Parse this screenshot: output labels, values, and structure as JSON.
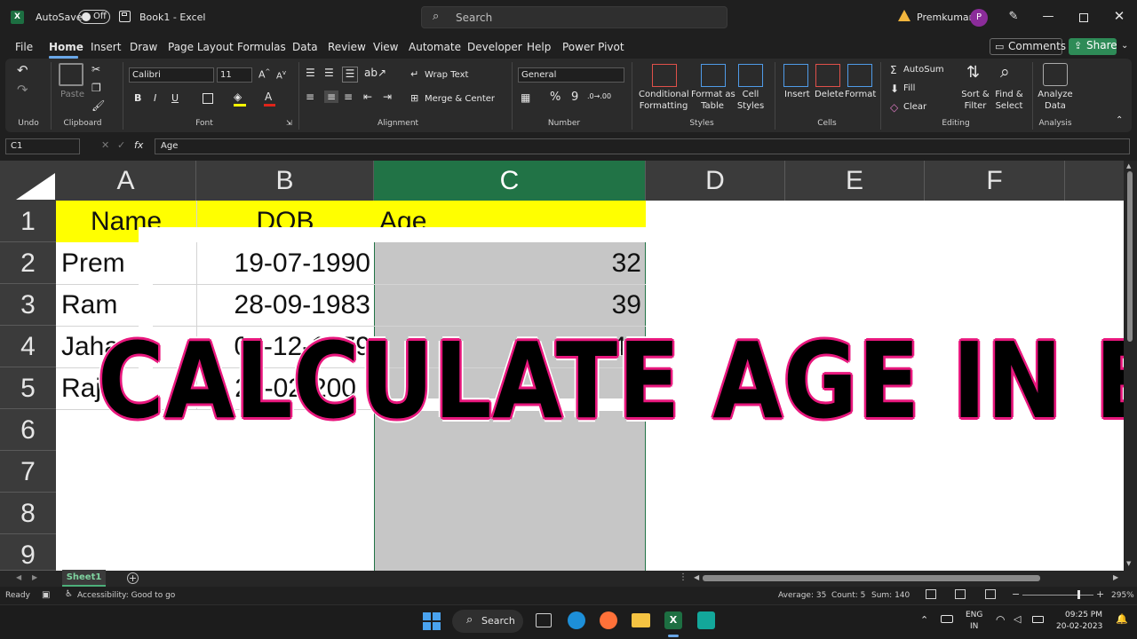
{
  "titlebar": {
    "autosave_label": "AutoSave",
    "autosave_state": "Off",
    "doc_title": "Book1  -  Excel",
    "search_placeholder": "Search",
    "user_name": "Premkumar",
    "avatar_initial": "P"
  },
  "menu": {
    "tabs": [
      "File",
      "Home",
      "Insert",
      "Draw",
      "Page Layout",
      "Formulas",
      "Data",
      "Review",
      "View",
      "Automate",
      "Developer",
      "Help",
      "Power Pivot"
    ],
    "active_tab": "Home",
    "comments_label": "Comments",
    "share_label": "Share"
  },
  "ribbon": {
    "undo_label": "Undo",
    "clipboard_label": "Clipboard",
    "paste_label": "Paste",
    "font_label": "Font",
    "font_name": "Calibri",
    "font_size": "11",
    "alignment_label": "Alignment",
    "wrap_text": "Wrap Text",
    "merge_center": "Merge & Center",
    "number_label": "Number",
    "number_format": "General",
    "styles_label": "Styles",
    "cond_format": [
      "Conditional",
      "Formatting"
    ],
    "format_table": [
      "Format as",
      "Table"
    ],
    "cell_styles": [
      "Cell",
      "Styles"
    ],
    "cells_label": "Cells",
    "insert": "Insert",
    "delete": "Delete",
    "format": "Format",
    "editing_label": "Editing",
    "autosum": "AutoSum",
    "fill": "Fill",
    "clear": "Clear",
    "sort_filter": [
      "Sort &",
      "Filter"
    ],
    "find_select": [
      "Find &",
      "Select"
    ],
    "analysis_label": "Analysis",
    "analyze_data": [
      "Analyze",
      "Data"
    ]
  },
  "formula_bar": {
    "name_box": "C1",
    "content": "Age"
  },
  "sheet": {
    "columns": [
      "A",
      "B",
      "C",
      "D",
      "E",
      "F"
    ],
    "rows": [
      "1",
      "2",
      "3",
      "4",
      "5",
      "6",
      "7",
      "8",
      "9"
    ],
    "header_row": {
      "a": "Name",
      "b": "DOB",
      "c": "Age"
    },
    "data": [
      {
        "a": "Prem",
        "b": "19-07-1990",
        "c": "32"
      },
      {
        "a": "Ram",
        "b": "28-09-1983",
        "c": "39"
      },
      {
        "a": "Jaha",
        "b": "06-12-1979",
        "c": "40"
      },
      {
        "a": "Raj",
        "b": "20-02-200",
        "c": "5"
      }
    ],
    "overlay_title": "CALCULATE AGE IN EXCEL",
    "sheet_tab": "Sheet1"
  },
  "status": {
    "ready": "Ready",
    "accessibility": "Accessibility: Good to go",
    "average": "Average: 35",
    "count": "Count: 5",
    "sum": "Sum: 140",
    "zoom": "295%"
  },
  "taskbar": {
    "search_label": "Search",
    "lang_top": "ENG",
    "lang_bottom": "IN",
    "time": "09:25 PM",
    "date": "20-02-2023"
  }
}
